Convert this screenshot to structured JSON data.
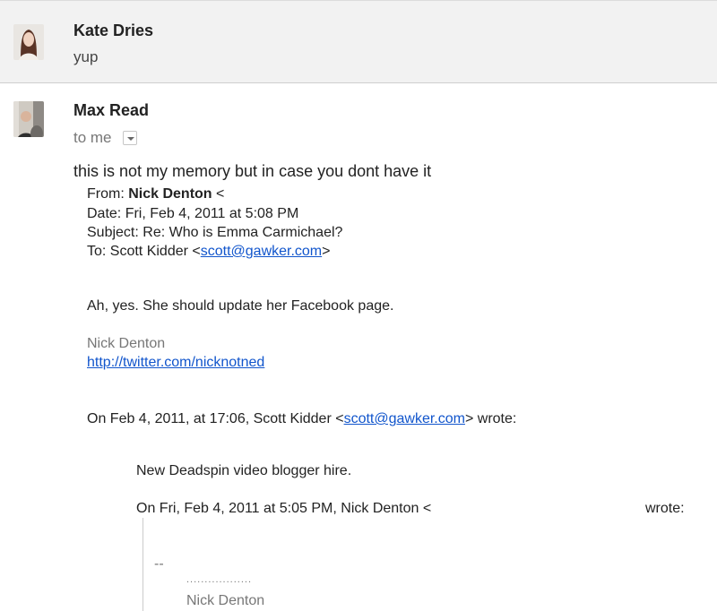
{
  "messages": [
    {
      "sender": "Kate Dries",
      "snippet": "yup"
    },
    {
      "sender": "Max Read",
      "to_label": "to me",
      "intro": "this is not my memory but in case you dont have it",
      "forwarded": {
        "from_label": "From:",
        "from_name": "Nick Denton",
        "from_tail": "<",
        "date_line": "Date: Fri, Feb 4, 2011 at 5:08 PM",
        "subject_line": "Subject: Re: Who is Emma Carmichael?",
        "to_prefix": "To: Scott Kidder <",
        "to_email": "scott@gawker.com",
        "to_suffix": ">",
        "reply_text": "Ah, yes. She should update her Facebook page.",
        "signature_name": "Nick Denton",
        "signature_link": "http://twitter.com/nicknotned",
        "quote1_prefix": "On Feb 4, 2011, at 17:06, Scott Kidder <",
        "quote1_email": "scott@gawker.com",
        "quote1_suffix": "> wrote:",
        "quote1_text": "New Deadspin video blogger hire.",
        "quote2_attribution": "On Fri, Feb 4, 2011 at 5:05 PM, Nick Denton <",
        "quote2_wrote": "wrote:",
        "dashes": "--",
        "dots": "..................",
        "sig2_name": "Nick Denton"
      }
    }
  ]
}
